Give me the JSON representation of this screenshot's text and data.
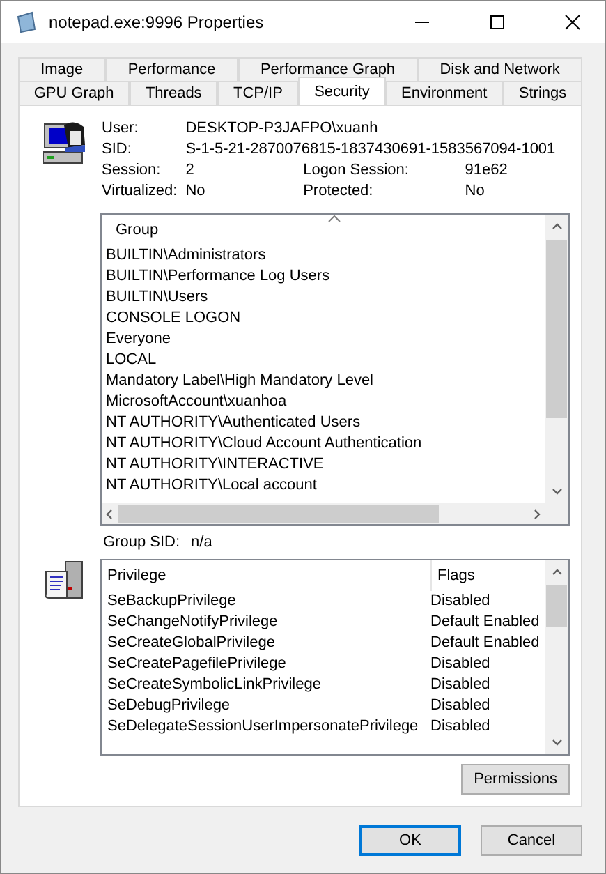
{
  "window": {
    "title": "notepad.exe:9996 Properties"
  },
  "tab_rows": [
    [
      {
        "label": "Image",
        "selected": false
      },
      {
        "label": "Performance",
        "selected": false
      },
      {
        "label": "Performance Graph",
        "selected": false
      },
      {
        "label": "Disk and Network",
        "selected": false
      }
    ],
    [
      {
        "label": "GPU Graph",
        "selected": false
      },
      {
        "label": "Threads",
        "selected": false
      },
      {
        "label": "TCP/IP",
        "selected": false
      },
      {
        "label": "Security",
        "selected": true
      },
      {
        "label": "Environment",
        "selected": false
      },
      {
        "label": "Strings",
        "selected": false
      }
    ]
  ],
  "user_info": {
    "user_label": "User:",
    "user": "DESKTOP-P3JAFPO\\xuanh",
    "sid_label": "SID:",
    "sid": "S-1-5-21-2870076815-1837430691-1583567094-1001",
    "session_label": "Session:",
    "session": "2",
    "logon_label": "Logon Session:",
    "logon": "91e62",
    "virtualized_label": "Virtualized:",
    "virtualized": "No",
    "protected_label": "Protected:",
    "protected": "No"
  },
  "groups": {
    "column": "Group",
    "rows": [
      "BUILTIN\\Administrators",
      "BUILTIN\\Performance Log Users",
      "BUILTIN\\Users",
      "CONSOLE LOGON",
      "Everyone",
      "LOCAL",
      "Mandatory Label\\High Mandatory Level",
      "MicrosoftAccount\\xuanhoa",
      "NT AUTHORITY\\Authenticated Users",
      "NT AUTHORITY\\Cloud Account Authentication",
      "NT AUTHORITY\\INTERACTIVE",
      "NT AUTHORITY\\Local account"
    ]
  },
  "group_sid": {
    "label": "Group SID:",
    "value": "n/a"
  },
  "privileges": {
    "columns": [
      "Privilege",
      "Flags"
    ],
    "rows": [
      {
        "name": "SeBackupPrivilege",
        "flags": "Disabled"
      },
      {
        "name": "SeChangeNotifyPrivilege",
        "flags": "Default Enabled"
      },
      {
        "name": "SeCreateGlobalPrivilege",
        "flags": "Default Enabled"
      },
      {
        "name": "SeCreatePagefilePrivilege",
        "flags": "Disabled"
      },
      {
        "name": "SeCreateSymbolicLinkPrivilege",
        "flags": "Disabled"
      },
      {
        "name": "SeDebugPrivilege",
        "flags": "Disabled"
      },
      {
        "name": "SeDelegateSessionUserImpersonatePrivilege",
        "flags": "Disabled"
      }
    ]
  },
  "permissions_button": "Permissions",
  "buttons": [
    "OK",
    "Cancel"
  ]
}
